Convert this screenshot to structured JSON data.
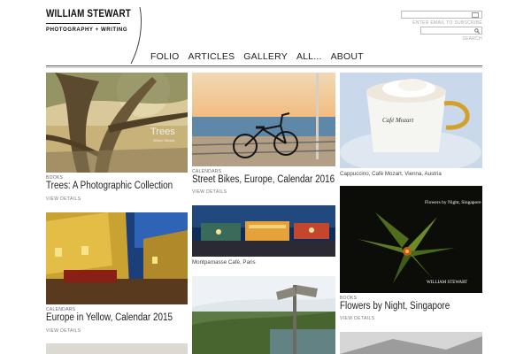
{
  "header": {
    "logo_name": "WILLIAM STEWART",
    "logo_sub": "PHOTOGRAPHY + WRITING",
    "subscribe_caption": "ENTER EMAIL TO SUBSCRIBE",
    "search_caption": "SEARCH"
  },
  "nav": [
    {
      "label": "FOLIO"
    },
    {
      "label": "ARTICLES"
    },
    {
      "label": "GALLERY"
    },
    {
      "label": "ALL..."
    },
    {
      "label": "ABOUT"
    }
  ],
  "cards": [
    {
      "category": "BOOKS",
      "title": "Trees: A Photographic Collection",
      "details": "VIEW DETAILS",
      "overlay": "Trees",
      "overlay_sub": "William Stewart"
    },
    {
      "category": "CALENDARS",
      "title": "Street Bikes, Europe, Calendar 2016",
      "details": "VIEW DETAILS"
    },
    {
      "caption": "Cappuccino, Café Mozart, Vienna, Austria",
      "cup_text": "Café Mozart"
    },
    {
      "category": "CALENDARS",
      "title": "Europe in Yellow, Calendar 2015",
      "details": "VIEW DETAILS"
    },
    {
      "caption": "Montparnasse Café, Paris"
    },
    {
      "category": "BOOKS",
      "title": "Flowers by Night, Singapore",
      "details": "VIEW DETAILS",
      "overlay": "Flowers by Night, Singapore",
      "overlay_sub": "WILLIAM STEWART"
    }
  ],
  "colors": {
    "text": "#222222",
    "rule": "#555555",
    "caption": "#777777"
  }
}
